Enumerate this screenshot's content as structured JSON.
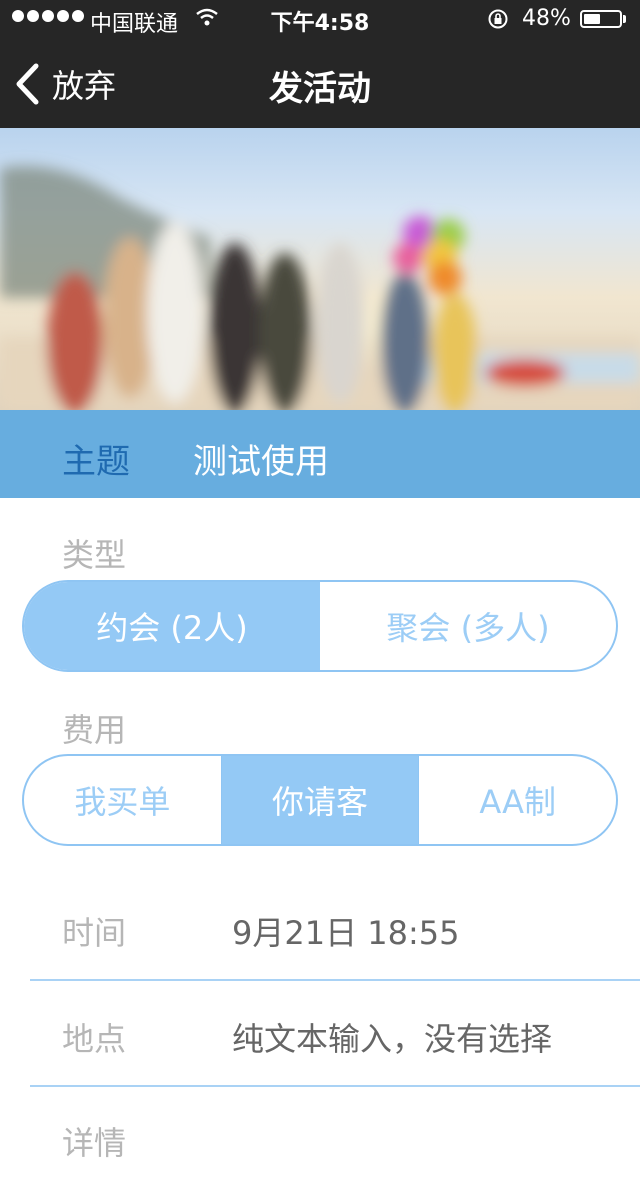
{
  "status_bar": {
    "carrier": "中国联通",
    "time": "下午4:58",
    "battery_percent": "48%",
    "battery_level": 0.48,
    "icons": [
      "signal-dots",
      "wifi-icon",
      "orientation-lock-icon",
      "battery-icon"
    ]
  },
  "nav": {
    "back_label": "放弃",
    "title": "发活动"
  },
  "subject": {
    "label": "主题",
    "value": "测试使用"
  },
  "type_section": {
    "label": "类型",
    "options": [
      "约会 (2人)",
      "聚会 (多人)"
    ],
    "selected_index": 0
  },
  "fee_section": {
    "label": "费用",
    "options": [
      "我买单",
      "你请客",
      "AA制"
    ],
    "selected_index": 1
  },
  "rows": {
    "time": {
      "label": "时间",
      "value": "9月21日 18:55"
    },
    "place": {
      "label": "地点",
      "value": "纯文本输入，没有选择"
    },
    "details": {
      "label": "详情"
    }
  },
  "colors": {
    "nav_bg": "#262626",
    "accent": "#67addf",
    "segment_active": "#94c9f5",
    "segment_border": "#8fc5f3",
    "label_gray": "#b6b6b6"
  }
}
